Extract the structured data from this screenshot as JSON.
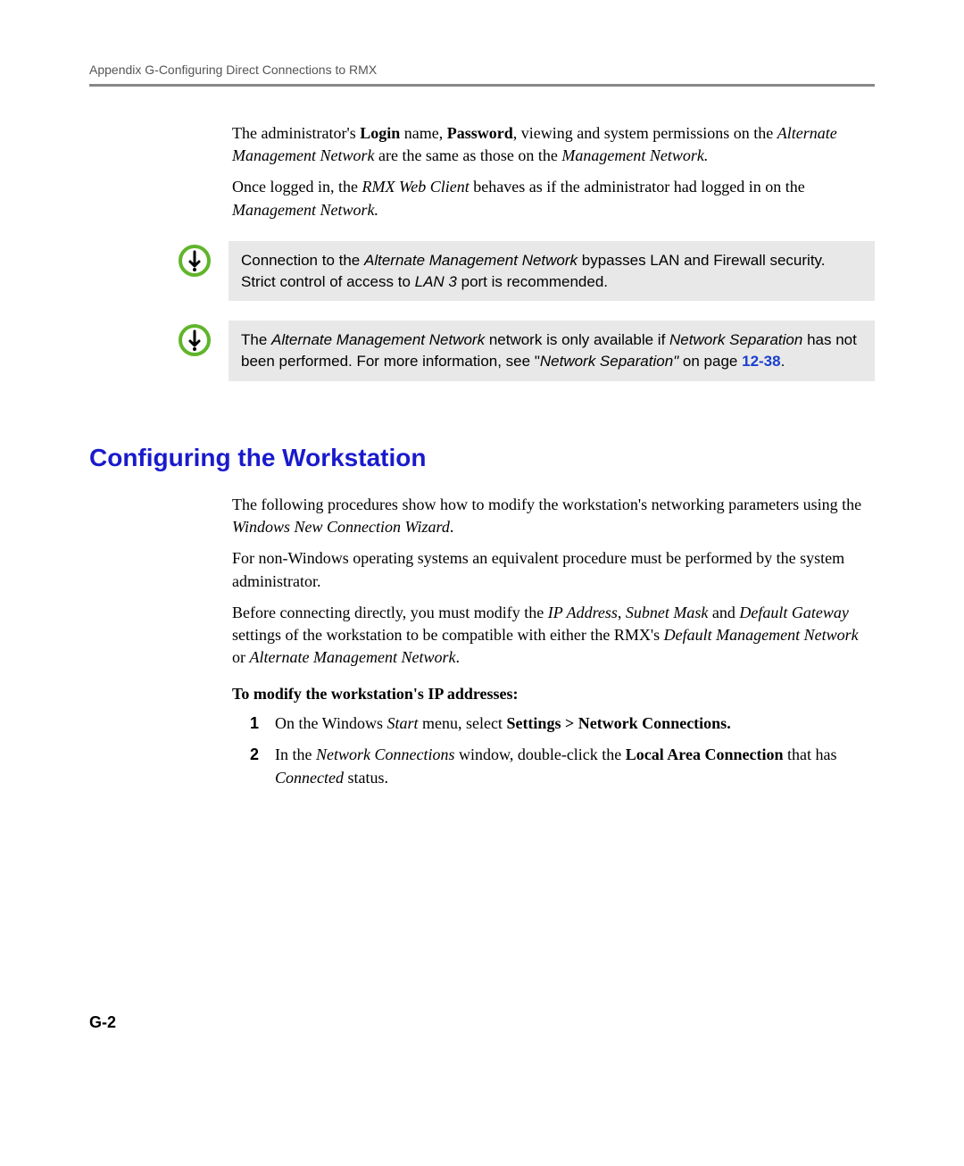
{
  "header": "Appendix G-Configuring Direct Connections to RMX",
  "intro": {
    "p1_pre": "The administrator's ",
    "p1_b1": "Login",
    "p1_mid1": " name, ",
    "p1_b2": "Password",
    "p1_mid2": ", viewing and system permissions on the ",
    "p1_i1": "Alternate Management Network",
    "p1_mid3": " are the same as those on the ",
    "p1_i2": "Management Network.",
    "p2_pre": "Once logged in, the ",
    "p2_i1": "RMX Web Client",
    "p2_mid": " behaves as if the administrator had logged in on the ",
    "p2_i2": "Management Network."
  },
  "note1": {
    "t1": "Connection to the ",
    "i1": "Alternate Management Network",
    "t2": " bypasses LAN and Firewall security. Strict control of access to ",
    "i2": "LAN 3",
    "t3": " port is recommended."
  },
  "note2": {
    "t1": "The ",
    "i1": "Alternate Management Network",
    "t2": " network is only available if ",
    "i2": "Network Separation",
    "t3": " has not been performed. For more information, see \"",
    "i3": "Network Separation\"",
    "t4": " on page ",
    "link": "12-38",
    "t5": "."
  },
  "section_title": "Configuring the Workstation",
  "body": {
    "p1_pre": "The following procedures show how to modify the workstation's networking parameters using the ",
    "p1_i1": "Windows New Connection Wizard",
    "p1_post": ".",
    "p2": "For non-Windows operating systems an equivalent procedure must be performed by the system administrator.",
    "p3_pre": "Before connecting directly, you must modify the ",
    "p3_i1": "IP Address",
    "p3_c1": ", ",
    "p3_i2": "Subnet Mask",
    "p3_mid": " and ",
    "p3_i3": "Default Gateway",
    "p3_mid2": " settings of the workstation to be compatible with either the RMX's ",
    "p3_i4": "Default Management Network",
    "p3_or": " or ",
    "p3_i5": "Alternate Management Network",
    "p3_post": "."
  },
  "subhead": "To modify the workstation's IP addresses:",
  "steps": {
    "n1": "1",
    "s1_pre": "On the Windows ",
    "s1_i1": "Start",
    "s1_mid": " menu, select ",
    "s1_b1": "Settings > Network Connections.",
    "n2": "2",
    "s2_pre": "In the ",
    "s2_i1": "Network Connections",
    "s2_mid": " window, double-click the ",
    "s2_b1": "Local Area Connection",
    "s2_mid2": " that has ",
    "s2_i2": "Connected",
    "s2_post": " status."
  },
  "footer": "G-2"
}
